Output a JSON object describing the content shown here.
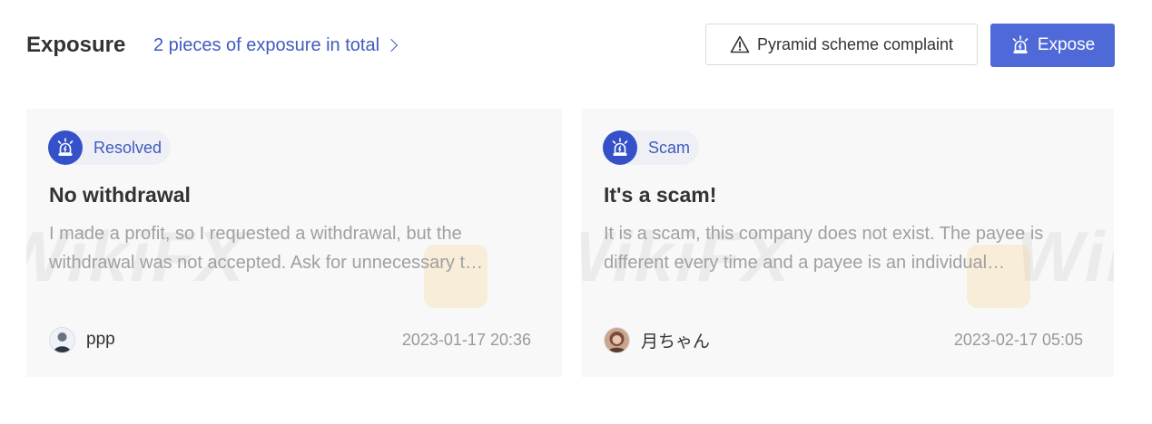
{
  "header": {
    "title": "Exposure",
    "total_link": "2 pieces of exposure in total",
    "complaint_button": "Pyramid scheme complaint",
    "expose_button": "Expose"
  },
  "cards": [
    {
      "status": "Resolved",
      "title": "No withdrawal",
      "description": "I made a profit, so I requested a withdrawal, but the withdrawal was not accepted. Ask for unnecessary t…",
      "user": "ppp",
      "date": "2023-01-17 20:36"
    },
    {
      "status": "Scam",
      "title": "It's a scam!",
      "description": "It is a scam, this company does not exist. The payee is different every time and a payee is an individual…",
      "user": "月ちゃん",
      "date": "2023-02-17 05:05"
    }
  ],
  "watermark": "WikiFX",
  "colors": {
    "accent": "#4f6ad8",
    "badge_icon_bg": "#3451c9",
    "link": "#3f5bc0",
    "card_bg": "#f8f8f9"
  },
  "icons": {
    "complaint": "warning-triangle-icon",
    "expose": "alarm-siren-icon",
    "badge": "alarm-siren-icon"
  }
}
